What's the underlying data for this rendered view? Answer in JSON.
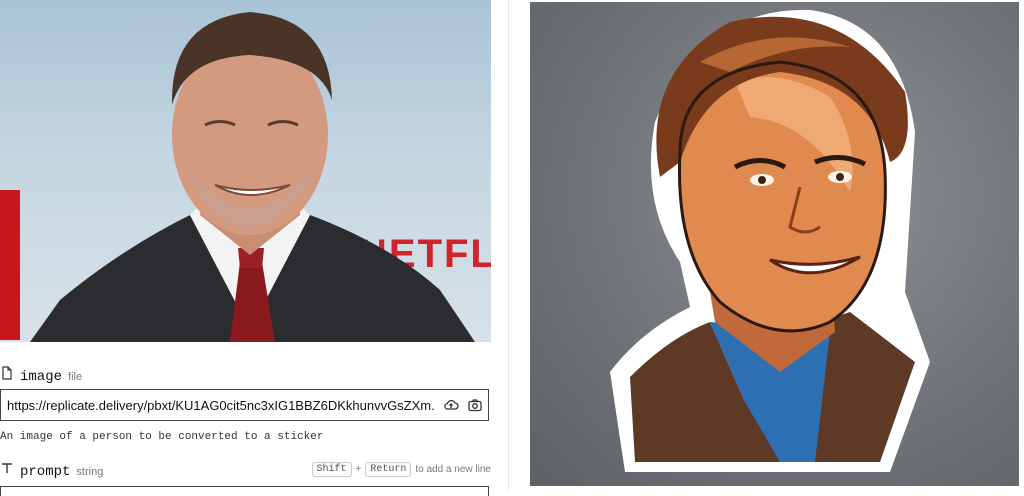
{
  "photo": {
    "sign_text": "NETFL"
  },
  "image_field": {
    "label": "image",
    "type": "file",
    "value": "https://replicate.delivery/pbxt/KU1AG0cit5nc3xIG1BBZ6DKkhunvvGsZXm...",
    "description": "An image of a person to be converted to a sticker"
  },
  "prompt_field": {
    "label": "prompt",
    "type": "string",
    "hint_key1": "Shift",
    "hint_plus": "+",
    "hint_key2": "Return",
    "hint_text": "to add a new line"
  },
  "icons": {
    "image_label": "file-icon",
    "prompt_label": "text-type-icon",
    "upload": "cloud-upload-icon",
    "camera": "camera-icon"
  },
  "colors": {
    "accent_red": "#d1232a",
    "output_bg": "#6e7277",
    "border": "#444444"
  }
}
